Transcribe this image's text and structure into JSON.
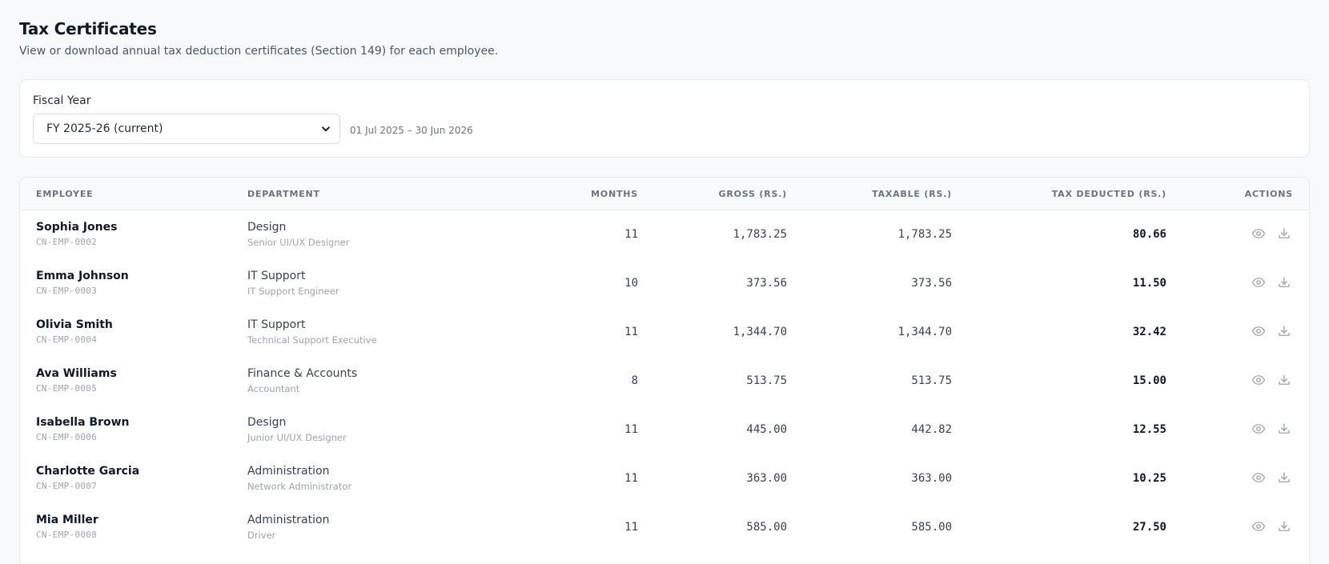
{
  "page": {
    "title": "Tax Certificates",
    "subtitle": "View or download annual tax deduction certificates (Section 149) for each employee."
  },
  "filter": {
    "label": "Fiscal Year",
    "selected": "FY 2025-26 (current)",
    "range": "01 Jul 2025 – 30 Jun 2026"
  },
  "table": {
    "columns": {
      "employee": "EMPLOYEE",
      "department": "DEPARTMENT",
      "months": "MONTHS",
      "gross": "GROSS (RS.)",
      "taxable": "TAXABLE (RS.)",
      "tax": "TAX DEDUCTED (RS.)",
      "actions": "ACTIONS"
    },
    "rows": [
      {
        "name": "Sophia Jones",
        "id": "CN-EMP-0002",
        "dept": "Design",
        "role": "Senior UI/UX Designer",
        "months": "11",
        "gross": "1,783.25",
        "taxable": "1,783.25",
        "tax": "80.66"
      },
      {
        "name": "Emma Johnson",
        "id": "CN-EMP-0003",
        "dept": "IT Support",
        "role": "IT Support Engineer",
        "months": "10",
        "gross": "373.56",
        "taxable": "373.56",
        "tax": "11.50"
      },
      {
        "name": "Olivia Smith",
        "id": "CN-EMP-0004",
        "dept": "IT Support",
        "role": "Technical Support Executive",
        "months": "11",
        "gross": "1,344.70",
        "taxable": "1,344.70",
        "tax": "32.42"
      },
      {
        "name": "Ava Williams",
        "id": "CN-EMP-0005",
        "dept": "Finance & Accounts",
        "role": "Accountant",
        "months": "8",
        "gross": "513.75",
        "taxable": "513.75",
        "tax": "15.00"
      },
      {
        "name": "Isabella Brown",
        "id": "CN-EMP-0006",
        "dept": "Design",
        "role": "Junior UI/UX Designer",
        "months": "11",
        "gross": "445.00",
        "taxable": "442.82",
        "tax": "12.55"
      },
      {
        "name": "Charlotte Garcia",
        "id": "CN-EMP-0007",
        "dept": "Administration",
        "role": "Network Administrator",
        "months": "11",
        "gross": "363.00",
        "taxable": "363.00",
        "tax": "10.25"
      },
      {
        "name": "Mia Miller",
        "id": "CN-EMP-0008",
        "dept": "Administration",
        "role": "Driver",
        "months": "11",
        "gross": "585.00",
        "taxable": "585.00",
        "tax": "27.50"
      }
    ]
  },
  "icons": {
    "view": "eye-icon",
    "download": "download-icon",
    "select": "chevron-down-icon"
  },
  "colors": {
    "background": "#f7f9fb",
    "card": "#ffffff",
    "border": "#e5e9ef",
    "muted": "#6b7280"
  }
}
